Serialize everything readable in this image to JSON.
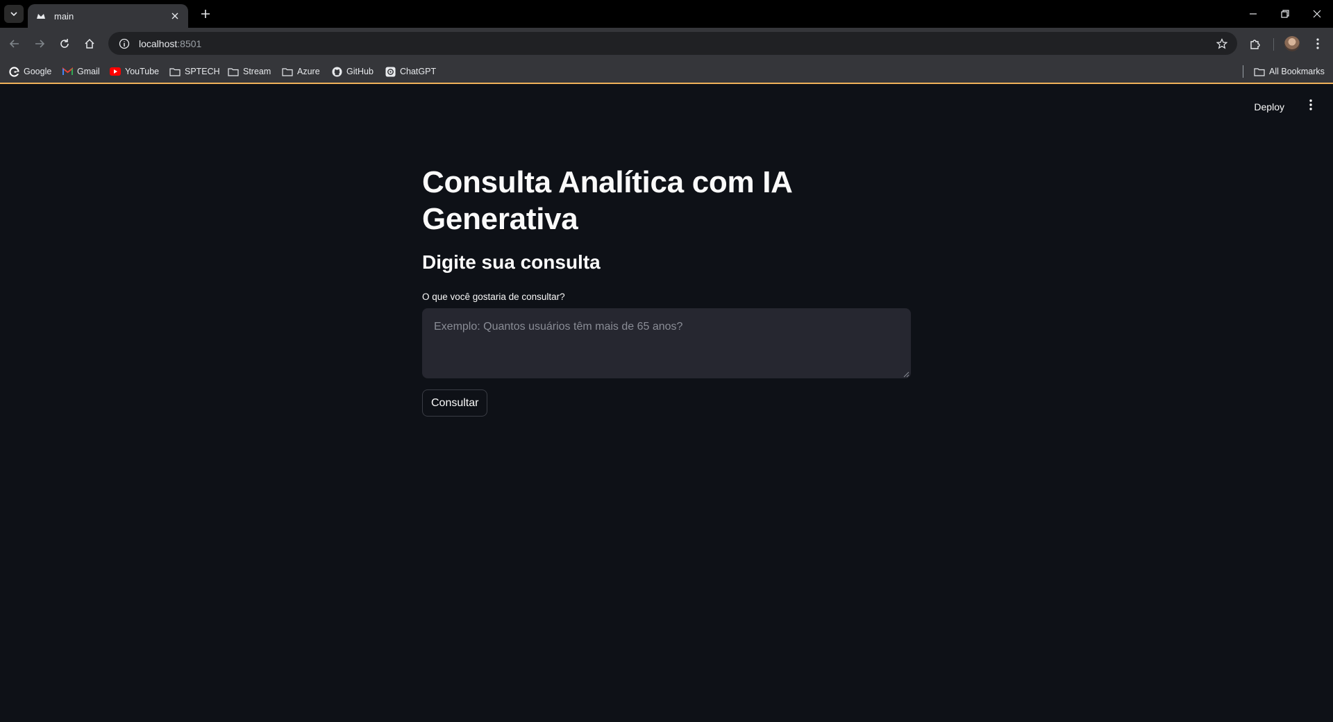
{
  "browser": {
    "tab_title": "main",
    "url_host": "localhost",
    "url_port": ":8501",
    "bookmarks": [
      "Google",
      "Gmail",
      "YouTube",
      "SPTECH",
      "Stream",
      "Azure",
      "GitHub",
      "ChatGPT"
    ],
    "all_bookmarks": "All Bookmarks"
  },
  "app": {
    "deploy_label": "Deploy",
    "title": "Consulta Analítica com IA Generativa",
    "subheader": "Digite sua consulta",
    "input_label": "O que você gostaria de consultar?",
    "input_placeholder": "Exemplo: Quantos usuários têm mais de 65 anos?",
    "input_value": "",
    "submit_label": "Consultar"
  },
  "colors": {
    "background": "#0e1117",
    "text": "#fafafa",
    "input_bg": "#262730",
    "chrome_bar": "#35363a",
    "bookmark_accent": "#f0b25a"
  }
}
